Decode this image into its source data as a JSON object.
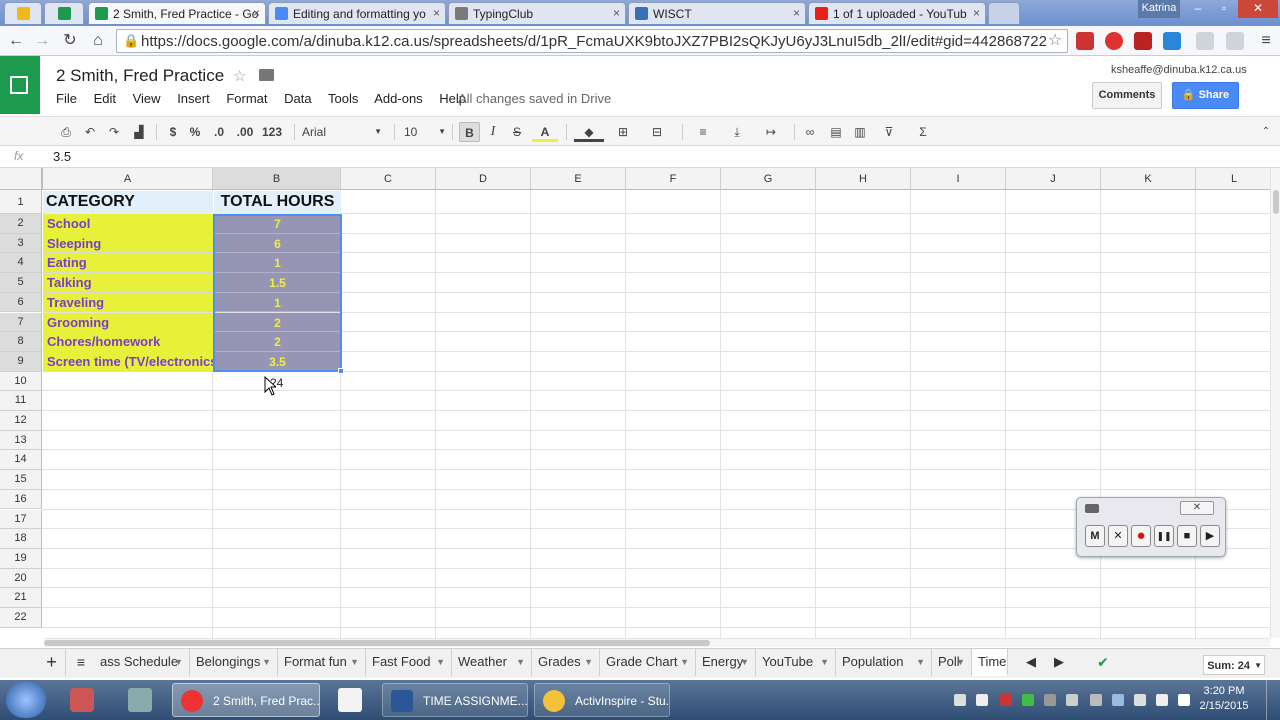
{
  "browser": {
    "tabs": [
      {
        "label": "",
        "color": "#f1b81c"
      },
      {
        "label": "",
        "color": "#1e9a4e"
      },
      {
        "label": "2 Smith, Fred Practice - Go",
        "color": "#1e9a4e"
      },
      {
        "label": "Editing and formatting yo",
        "color": "#4a8af4"
      },
      {
        "label": "TypingClub",
        "color": "#7a7a7a"
      },
      {
        "label": "WISCT",
        "color": "#3b6fb6"
      },
      {
        "label": "1 of 1 uploaded - YouTub",
        "color": "#e62117"
      }
    ],
    "user_badge": "Katrina",
    "url": "https://docs.google.com/a/dinuba.k12.ca.us/spreadsheets/d/1pR_FcmaUXK9btoJXZ7PBI2sQKJyU6yJ3LnuI5db_2lI/edit#gid=442868722"
  },
  "sheets": {
    "doc_title": "2 Smith, Fred Practice",
    "menus": [
      "File",
      "Edit",
      "View",
      "Insert",
      "Format",
      "Data",
      "Tools",
      "Add-ons",
      "Help"
    ],
    "save_status": "All changes saved in Drive",
    "account": "ksheaffe@dinuba.k12.ca.us",
    "comments_label": "Comments",
    "share_label": "Share"
  },
  "toolbar": {
    "currency": "$",
    "percent": "%",
    "dec_less": ".0",
    "dec_more": ".00",
    "more_formats": "123",
    "font": "Arial",
    "font_size": "10",
    "bold": "B",
    "italic": "I",
    "strike": "S",
    "text_color": "A"
  },
  "formula_bar": {
    "fx": "fx",
    "value": "3.5"
  },
  "grid": {
    "columns": [
      "A",
      "B",
      "C",
      "D",
      "E",
      "F",
      "G",
      "H",
      "I",
      "J",
      "K",
      "L"
    ],
    "rows": [
      "1",
      "2",
      "3",
      "4",
      "5",
      "6",
      "7",
      "8",
      "9",
      "10",
      "11",
      "12",
      "13",
      "14",
      "15",
      "16",
      "17",
      "18",
      "19",
      "20",
      "21",
      "22"
    ],
    "header": {
      "category": "CATEGORY",
      "total": "TOTAL HOURS"
    },
    "data": [
      {
        "category": "School",
        "hours": "7"
      },
      {
        "category": "Sleeping",
        "hours": "6"
      },
      {
        "category": "Eating",
        "hours": "1"
      },
      {
        "category": "Talking",
        "hours": "1.5"
      },
      {
        "category": "Traveling",
        "hours": "1"
      },
      {
        "category": "Grooming",
        "hours": "2"
      },
      {
        "category": "Chores/homework",
        "hours": "2"
      },
      {
        "category": "Screen time (TV/electronics)",
        "hours": "3.5"
      }
    ],
    "sum_cell": "24"
  },
  "recorder": {
    "close": "✕",
    "buttons": [
      "M",
      "✕",
      "●",
      "❚❚",
      "■",
      "▶"
    ]
  },
  "sheet_tabs": {
    "tabs": [
      "ass Schedule",
      "Belongings",
      "Format fun",
      "Fast Food",
      "Weather",
      "Grades",
      "Grade Chart",
      "Energy",
      "YouTube",
      "Population",
      "Poll",
      "Time"
    ],
    "sum_label": "Sum: 24"
  },
  "taskbar": {
    "items": [
      "2 Smith, Fred Prac...",
      "TIME ASSIGNME...",
      "ActivInspire - Stu..."
    ],
    "time": "3:20 PM",
    "date": "2/15/2015"
  }
}
